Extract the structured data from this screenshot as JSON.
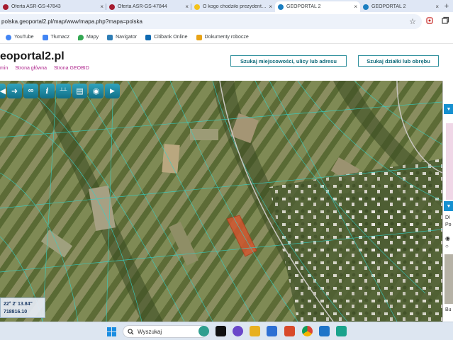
{
  "browser": {
    "tabs": [
      {
        "title": "Oferta ASR-GS-47843",
        "color": "#a51c30",
        "active": false
      },
      {
        "title": "Oferta ASR-GS-47844",
        "color": "#a51c30",
        "active": false
      },
      {
        "title": "O kogo chodziło prezydent…",
        "color": "#f3c21a",
        "active": false
      },
      {
        "title": "GEOPORTAL 2",
        "color": "#1a7ec1",
        "active": true
      },
      {
        "title": "GEOPORTAL 2",
        "color": "#1a7ec1",
        "active": false
      }
    ],
    "close_glyph": "×",
    "new_tab_glyph": "+",
    "url": "polska.geoportal2.pl/map/www/mapa.php?mapa=polska",
    "star_glyph": "☆"
  },
  "bookmarks": [
    {
      "label": "YouTube",
      "icon": "google-icon",
      "color": "#4285f4"
    },
    {
      "label": "Tłumacz",
      "icon": "translate-icon",
      "color": "#4285f4"
    },
    {
      "label": "Mapy",
      "icon": "maps-pin-icon",
      "color": "#34a853"
    },
    {
      "label": "Navigator",
      "icon": "navigator-icon",
      "color": "#2e7db5"
    },
    {
      "label": "Citibank Online",
      "icon": "citibank-icon",
      "color": "#0f6ab1"
    },
    {
      "label": "Dokumenty robocze",
      "icon": "document-icon",
      "color": "#e8a317"
    }
  ],
  "site": {
    "brand": "eoportal2.pl",
    "links": [
      "min",
      "Strona główna",
      "Strona GEOBID"
    ],
    "search_place_button": "Szukaj miejscowości, ulicy lub adresu",
    "search_parcel_button": "Szukaj działki lub obrębu"
  },
  "toolbar": {
    "tools": [
      {
        "name": "pan-left-tool",
        "glyph": "◀"
      },
      {
        "name": "arrow-right-tool",
        "glyph": "➜"
      },
      {
        "name": "link-tool",
        "glyph": "∞"
      },
      {
        "name": "info-tool",
        "glyph": "i"
      },
      {
        "name": "measure-tool",
        "glyph": "┴┴"
      },
      {
        "name": "print-tool",
        "glyph": "▤"
      },
      {
        "name": "globe-tool",
        "glyph": "◉"
      },
      {
        "name": "camera-tool",
        "glyph": "▶"
      }
    ]
  },
  "coords": {
    "lon": "22° 2' 13.84\"",
    "y": "718816.10"
  },
  "right_panel": {
    "label1": "Dł",
    "label2": "Po",
    "label3": "Bu"
  },
  "taskbar": {
    "search_placeholder": "Wyszukaj",
    "apps": [
      {
        "name": "copilot-icon",
        "color": "#2f9e8f"
      },
      {
        "name": "meet-icon",
        "color": "#6a47c9"
      },
      {
        "name": "file-explorer-icon",
        "color": "#e8b021"
      },
      {
        "name": "store-icon",
        "color": "#2d6fd3"
      },
      {
        "name": "paint-icon",
        "color": "#d84a2b"
      },
      {
        "name": "chrome-icon",
        "color": "#2d9b46"
      },
      {
        "name": "mail-icon",
        "color": "#1e74c9"
      },
      {
        "name": "chat-icon",
        "color": "#19a38c"
      }
    ]
  }
}
